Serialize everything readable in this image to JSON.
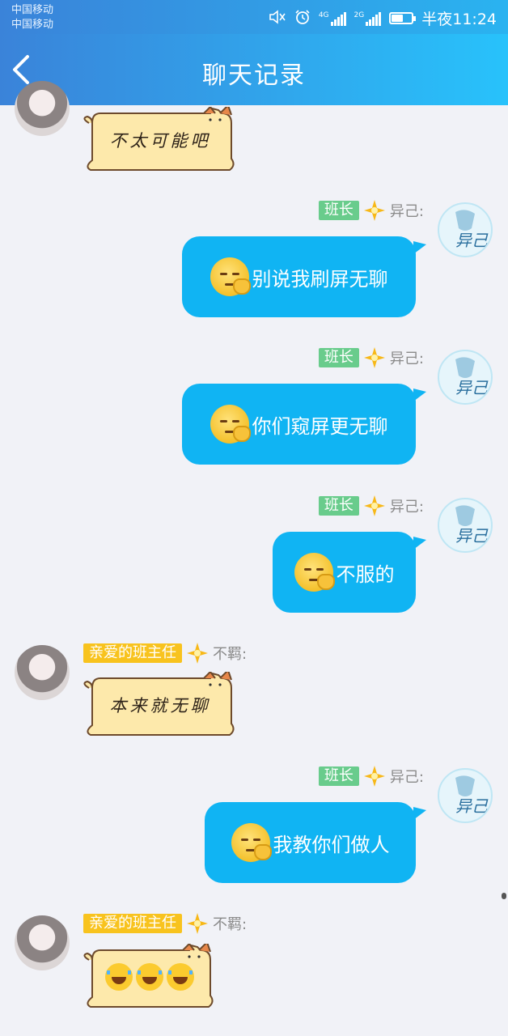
{
  "status_bar": {
    "carrier1": "中国移动",
    "carrier2": "中国移动",
    "net1": "4G",
    "net2": "2G",
    "battery_level": 0.6,
    "time": "半夜11:24"
  },
  "header": {
    "title": "聊天记录"
  },
  "messages": [
    {
      "side": "left",
      "sticker_text": "不太可能吧"
    },
    {
      "side": "right",
      "badge": "班长",
      "sender": "异己:",
      "text": "别说我刷屏无聊"
    },
    {
      "side": "right",
      "badge": "班长",
      "sender": "异己:",
      "text": "你们窥屏更无聊"
    },
    {
      "side": "right",
      "badge": "班长",
      "sender": "异己:",
      "text": "不服的"
    },
    {
      "side": "left",
      "badge": "亲爱的班主任",
      "sender": "不羁:",
      "sticker_text": "本来就无聊"
    },
    {
      "side": "right",
      "badge": "班长",
      "sender": "异己:",
      "text": "我教你们做人"
    },
    {
      "side": "left",
      "badge": "亲爱的班主任",
      "sender": "不羁:",
      "sticker_text": "😂😂😂"
    }
  ],
  "self_avatar_text": "异己",
  "colors": {
    "accent": "#10b4f3",
    "header_start": "#3a83d9",
    "header_end": "#28c2fb",
    "badge_green": "#69cc8c",
    "badge_yellow": "#f8c31e"
  }
}
